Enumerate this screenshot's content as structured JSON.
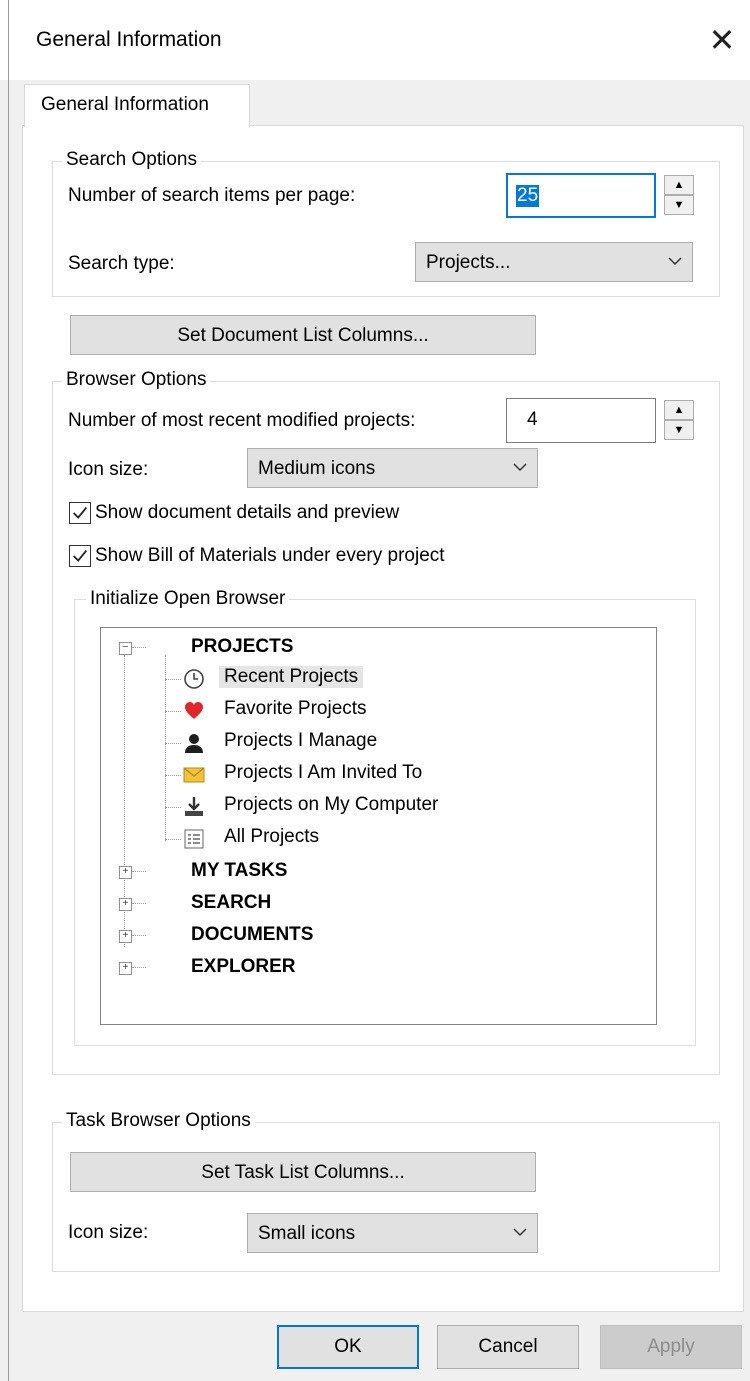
{
  "window": {
    "title": "General Information",
    "close_glyph": "✕"
  },
  "tabs": [
    {
      "label": "General Information"
    }
  ],
  "search_options": {
    "legend": "Search Options",
    "items_per_page_label": "Number of search items per page:",
    "items_per_page_value": "25",
    "search_type_label": "Search type:",
    "search_type_value": "Projects...",
    "set_document_columns_button": "Set Document List Columns..."
  },
  "browser_options": {
    "legend": "Browser Options",
    "recent_label": "Number of most recent modified projects:",
    "recent_value": "4",
    "icon_size_label": "Icon size:",
    "icon_size_value": "Medium icons",
    "show_details_label": "Show document details and preview",
    "show_details_checked": true,
    "show_bom_label": "Show Bill of Materials under every project",
    "show_bom_checked": true
  },
  "initialize_open_browser": {
    "legend": "Initialize Open Browser",
    "tree": {
      "projects": {
        "label": "PROJECTS",
        "expanded": true,
        "children": [
          {
            "label": "Recent Projects",
            "icon": "clock-icon",
            "selected": true
          },
          {
            "label": "Favorite Projects",
            "icon": "heart-icon"
          },
          {
            "label": "Projects I Manage",
            "icon": "person-icon"
          },
          {
            "label": "Projects I Am Invited To",
            "icon": "envelope-icon"
          },
          {
            "label": "Projects on My Computer",
            "icon": "download-icon"
          },
          {
            "label": "All Projects",
            "icon": "list-icon"
          }
        ]
      },
      "collapsed_roots": [
        {
          "label": "MY TASKS"
        },
        {
          "label": "SEARCH"
        },
        {
          "label": "DOCUMENTS"
        },
        {
          "label": "EXPLORER"
        }
      ]
    }
  },
  "task_browser_options": {
    "legend": "Task Browser Options",
    "set_task_columns_button": "Set Task List Columns...",
    "icon_size_label": "Icon size:",
    "icon_size_value": "Small icons"
  },
  "footer": {
    "ok": "OK",
    "cancel": "Cancel",
    "apply": "Apply"
  },
  "colors": {
    "focus_blue": "#0078d7",
    "selection": "#e5e5e5",
    "disabled_text": "#8c8c8c",
    "heart": "#e0262d",
    "envelope": "#f2c23c"
  }
}
